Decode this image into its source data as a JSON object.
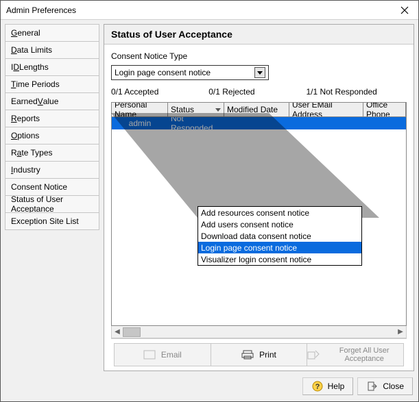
{
  "window": {
    "title": "Admin Preferences"
  },
  "sidebar": {
    "items": [
      {
        "pre": "",
        "hot": "G",
        "post": "eneral"
      },
      {
        "pre": "",
        "hot": "D",
        "post": "ata Limits"
      },
      {
        "pre": "I",
        "hot": "D",
        "post": " Lengths"
      },
      {
        "pre": "",
        "hot": "T",
        "post": "ime Periods"
      },
      {
        "pre": "Earned ",
        "hot": "V",
        "post": "alue"
      },
      {
        "pre": "",
        "hot": "R",
        "post": "eports"
      },
      {
        "pre": "",
        "hot": "O",
        "post": "ptions"
      },
      {
        "pre": "R",
        "hot": "a",
        "post": "te Types"
      },
      {
        "pre": "",
        "hot": "I",
        "post": "ndustry"
      },
      {
        "pre": "Consent Notice",
        "hot": "",
        "post": ""
      },
      {
        "pre": "Status of User Acceptance",
        "hot": "",
        "post": ""
      },
      {
        "pre": "Exception Site List",
        "hot": "",
        "post": ""
      }
    ]
  },
  "panel": {
    "title": "Status of User Acceptance",
    "combo_label": "Consent Notice Type",
    "combo_value": "Login page consent notice",
    "counts": {
      "accepted": "0/1 Accepted",
      "rejected": "0/1 Rejected",
      "not_responded": "1/1 Not Responded"
    },
    "columns": [
      "Personal Name",
      "Status",
      "Modified Date",
      "User EMail Address",
      "Office Phone"
    ],
    "rows": [
      {
        "personal_name": "admin",
        "status": "Not Responded",
        "modified_date": "",
        "email": "",
        "office_phone": ""
      }
    ],
    "dropdown_items": [
      "Add resources consent notice",
      "Add users consent notice",
      "Download data consent notice",
      "Login page consent notice",
      "Visualizer login consent notice"
    ],
    "dropdown_highlight_index": 3,
    "actions": {
      "email": "Email",
      "print": "Print",
      "forget": "Forget All User Acceptance"
    }
  },
  "bottom": {
    "help": "Help",
    "close": "Close"
  }
}
